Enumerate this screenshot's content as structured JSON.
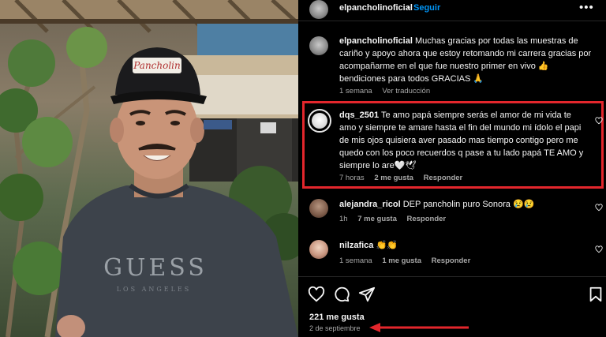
{
  "post": {
    "author": "elpancholinoficial",
    "follow_label": "Seguir",
    "more_icon": "more-horizontal-icon",
    "close_icon": "close-icon",
    "cap_logo_text": "Pancholin",
    "shirt_brand": "GUESS",
    "shirt_sub": "LOS ANGELES"
  },
  "comments": [
    {
      "username": "elpancholinoficial",
      "text": "Muchas gracias por todas las muestras de cariño y apoyo ahora que estoy retomando mi carrera gracias por acompañarme en el que fue nuestro primer en vivo 👍 bendiciones para todos GRACIAS 🙏",
      "time": "1 semana",
      "likes": "",
      "reply": "Ver traducción"
    },
    {
      "username": "dqs_2501",
      "text": "Te amo papá siempre serás el amor de mi vida te amo y siempre te amare hasta el fin del mundo mi ídolo el papi de mis ojos quisiera aver pasado mas tiempo contigo pero me quedo con los poco recuerdos q pase a tu lado papá TE AMO y siempre lo are🤍🕊",
      "time": "7 horas",
      "likes": "2 me gusta",
      "reply": "Responder"
    },
    {
      "username": "alejandra_ricol",
      "text": "DEP pancholin puro Sonora 😢😢",
      "time": "1h",
      "likes": "7 me gusta",
      "reply": "Responder"
    },
    {
      "username": "nilzafica",
      "text": "👏👏",
      "time": "1 semana",
      "likes": "1 me gusta",
      "reply": "Responder"
    }
  ],
  "footer": {
    "likes": "221 me gusta",
    "date": "2 de septiembre"
  },
  "colors": {
    "highlight": "#e3262c",
    "follow": "#0095f6",
    "background": "#000000"
  }
}
